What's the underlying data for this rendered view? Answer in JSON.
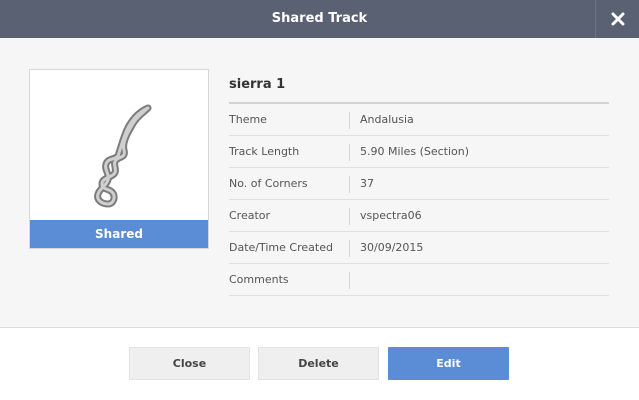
{
  "dialog": {
    "title": "Shared Track"
  },
  "thumbnail": {
    "status_label": "Shared"
  },
  "track": {
    "name": "sierra 1",
    "rows": [
      {
        "label": "Theme",
        "value": "Andalusia"
      },
      {
        "label": "Track Length",
        "value": "5.90 Miles (Section)"
      },
      {
        "label": "No. of Corners",
        "value": "37"
      },
      {
        "label": "Creator",
        "value": "vspectra06"
      },
      {
        "label": "Date/Time Created",
        "value": "30/09/2015"
      },
      {
        "label": "Comments",
        "value": ""
      }
    ]
  },
  "buttons": {
    "close_label": "Close",
    "delete_label": "Delete",
    "edit_label": "Edit"
  },
  "colors": {
    "titlebar": "#5a6172",
    "accent": "#5b8dd6"
  }
}
